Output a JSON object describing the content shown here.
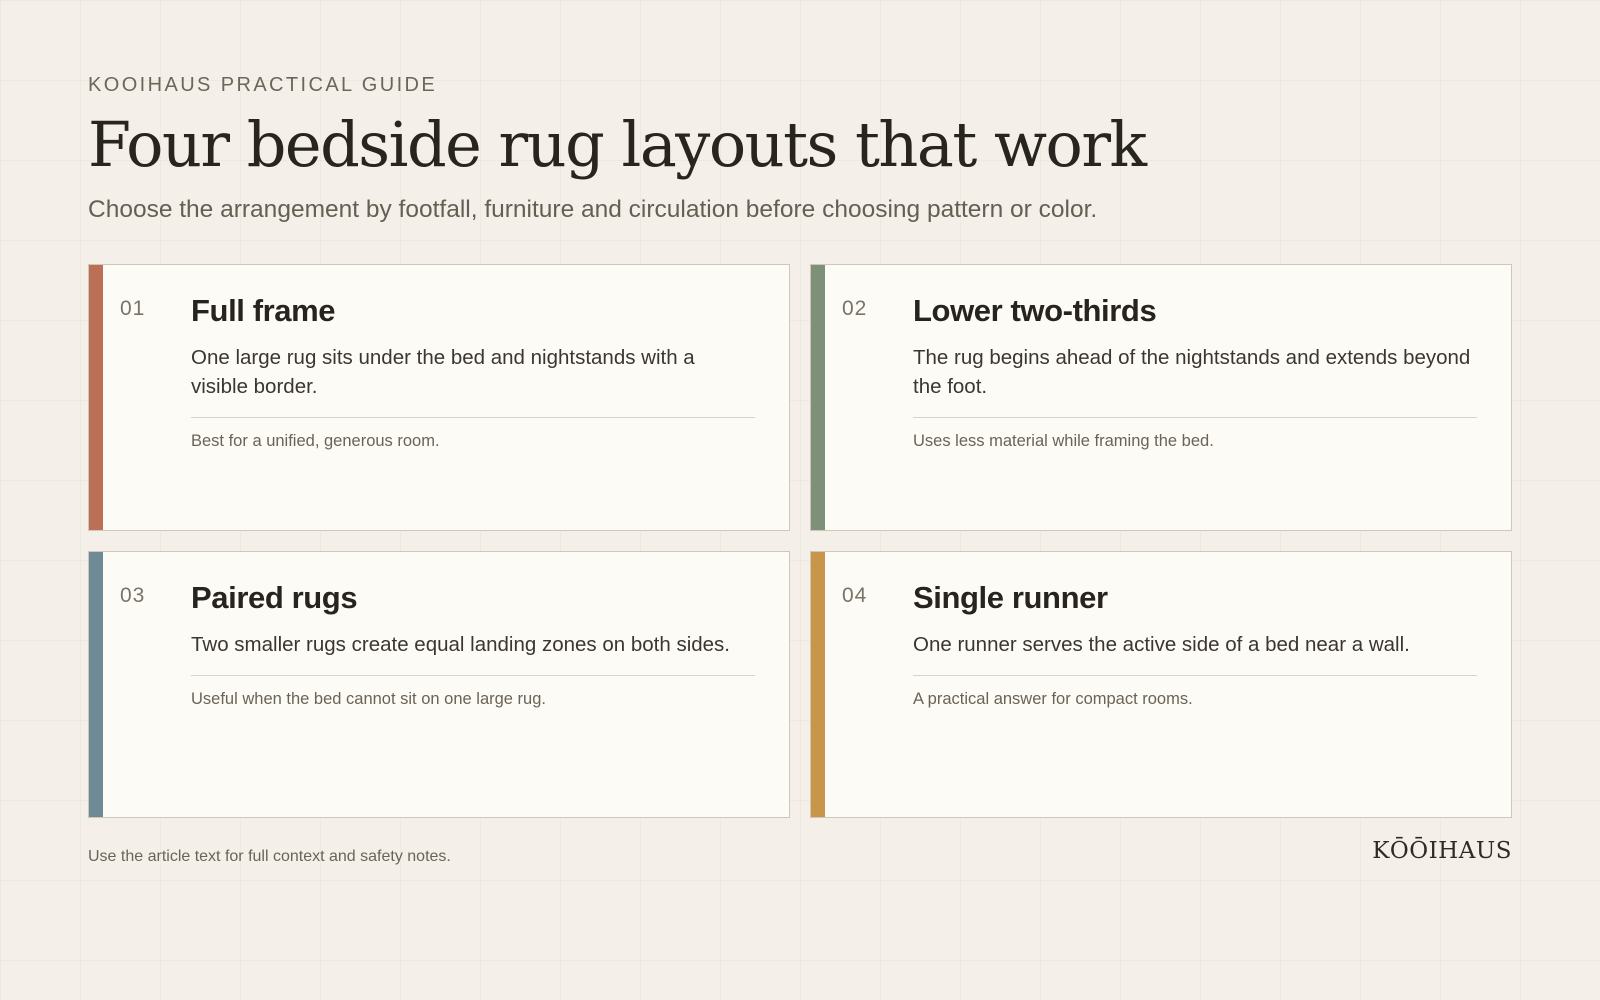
{
  "header": {
    "eyebrow": "KOOIHAUS PRACTICAL GUIDE",
    "title": "Four bedside rug layouts that work",
    "subtitle": "Choose the arrangement by footfall, furniture and circulation before choosing pattern or color."
  },
  "cards": [
    {
      "number": "01",
      "title": "Full frame",
      "description": "One large rug sits under the bed and nightstands with a visible border.",
      "note": "Best for a unified, generous room.",
      "accent_color": "#bb6f55"
    },
    {
      "number": "02",
      "title": "Lower two-thirds",
      "description": "The rug begins ahead of the nightstands and extends beyond the foot.",
      "note": "Uses less material while framing the bed.",
      "accent_color": "#7d9178"
    },
    {
      "number": "03",
      "title": "Paired rugs",
      "description": "Two smaller rugs create equal landing zones on both sides.",
      "note": "Useful when the bed cannot sit on one large rug.",
      "accent_color": "#6e8a96"
    },
    {
      "number": "04",
      "title": "Single runner",
      "description": "One runner serves the active side of a bed near a wall.",
      "note": "A practical answer for compact rooms.",
      "accent_color": "#c8964a"
    }
  ],
  "footer": {
    "note": "Use the article text for full context and safety notes.",
    "logo": "KŌŌIHAUS"
  }
}
